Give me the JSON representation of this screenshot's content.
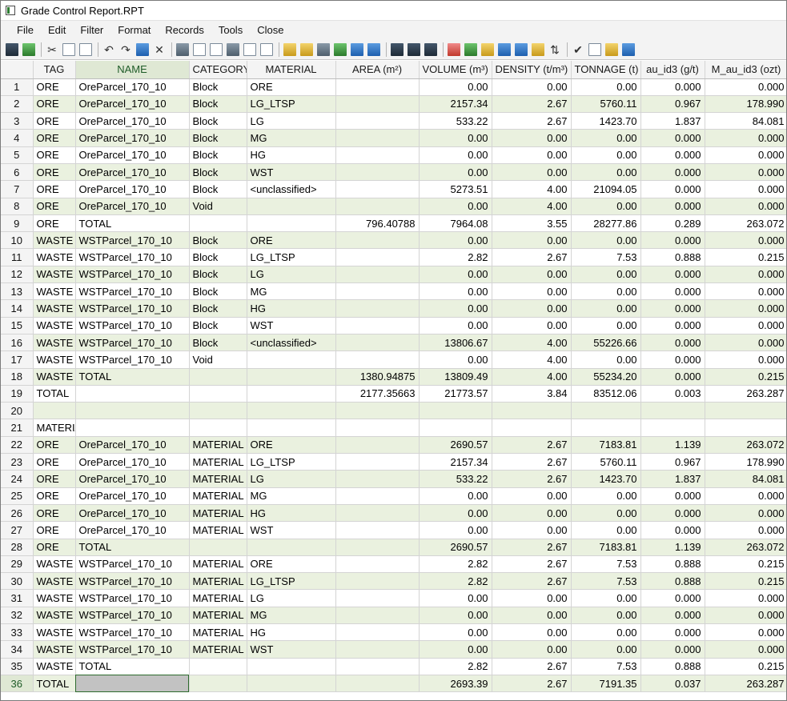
{
  "window": {
    "title": "Grade Control Report.RPT"
  },
  "menu": [
    "File",
    "Edit",
    "Filter",
    "Format",
    "Records",
    "Tools",
    "Close"
  ],
  "toolbar": {
    "icons": [
      "save-icon",
      "save-as-icon",
      "cut-icon",
      "copy-icon",
      "paste-icon",
      "undo-icon",
      "redo-icon",
      "insert-row-icon",
      "delete-icon",
      "filter-icon",
      "columns-icon",
      "format-icon",
      "wrap-icon",
      "decimal-increase-icon",
      "decimal-decrease-icon",
      "edit-icon",
      "edit-alt-icon",
      "export-icon",
      "add-column-icon",
      "import-icon",
      "download-icon",
      "calc-icon",
      "calc-alt-icon",
      "calc-edit-icon",
      "clear-icon",
      "table-icon",
      "chart-edit-icon",
      "merge-icon",
      "split-icon",
      "sort-icon",
      "sort-az-icon",
      "check-icon",
      "report-icon",
      "bar-chart-icon",
      "book-icon"
    ]
  },
  "grid": {
    "columns": [
      "TAG",
      "NAME",
      "CATEGORY",
      "MATERIAL",
      "AREA (m²)",
      "VOLUME (m³)",
      "DENSITY (t/m³)",
      "TONNAGE (t)",
      "au_id3 (g/t)",
      "M_au_id3 (ozt)"
    ],
    "rows": [
      {
        "n": "1",
        "band": false,
        "c": [
          "ORE",
          "OreParcel_170_10",
          "Block",
          "ORE",
          "",
          "0.00",
          "0.00",
          "0.00",
          "0.000",
          "0.000"
        ]
      },
      {
        "n": "2",
        "band": true,
        "c": [
          "ORE",
          "OreParcel_170_10",
          "Block",
          "LG_LTSP",
          "",
          "2157.34",
          "2.67",
          "5760.11",
          "0.967",
          "178.990"
        ]
      },
      {
        "n": "3",
        "band": false,
        "c": [
          "ORE",
          "OreParcel_170_10",
          "Block",
          "LG",
          "",
          "533.22",
          "2.67",
          "1423.70",
          "1.837",
          "84.081"
        ]
      },
      {
        "n": "4",
        "band": true,
        "c": [
          "ORE",
          "OreParcel_170_10",
          "Block",
          "MG",
          "",
          "0.00",
          "0.00",
          "0.00",
          "0.000",
          "0.000"
        ]
      },
      {
        "n": "5",
        "band": false,
        "c": [
          "ORE",
          "OreParcel_170_10",
          "Block",
          "HG",
          "",
          "0.00",
          "0.00",
          "0.00",
          "0.000",
          "0.000"
        ]
      },
      {
        "n": "6",
        "band": true,
        "c": [
          "ORE",
          "OreParcel_170_10",
          "Block",
          "WST",
          "",
          "0.00",
          "0.00",
          "0.00",
          "0.000",
          "0.000"
        ]
      },
      {
        "n": "7",
        "band": false,
        "c": [
          "ORE",
          "OreParcel_170_10",
          "Block",
          "<unclassified>",
          "",
          "5273.51",
          "4.00",
          "21094.05",
          "0.000",
          "0.000"
        ]
      },
      {
        "n": "8",
        "band": true,
        "c": [
          "ORE",
          "OreParcel_170_10",
          "Void",
          "",
          "",
          "0.00",
          "4.00",
          "0.00",
          "0.000",
          "0.000"
        ]
      },
      {
        "n": "9",
        "band": false,
        "c": [
          "ORE",
          "TOTAL",
          "",
          "",
          "796.40788",
          "7964.08",
          "3.55",
          "28277.86",
          "0.289",
          "263.072"
        ]
      },
      {
        "n": "10",
        "band": true,
        "c": [
          "WASTE",
          "WSTParcel_170_10",
          "Block",
          "ORE",
          "",
          "0.00",
          "0.00",
          "0.00",
          "0.000",
          "0.000"
        ]
      },
      {
        "n": "11",
        "band": false,
        "c": [
          "WASTE",
          "WSTParcel_170_10",
          "Block",
          "LG_LTSP",
          "",
          "2.82",
          "2.67",
          "7.53",
          "0.888",
          "0.215"
        ]
      },
      {
        "n": "12",
        "band": true,
        "c": [
          "WASTE",
          "WSTParcel_170_10",
          "Block",
          "LG",
          "",
          "0.00",
          "0.00",
          "0.00",
          "0.000",
          "0.000"
        ]
      },
      {
        "n": "13",
        "band": false,
        "c": [
          "WASTE",
          "WSTParcel_170_10",
          "Block",
          "MG",
          "",
          "0.00",
          "0.00",
          "0.00",
          "0.000",
          "0.000"
        ]
      },
      {
        "n": "14",
        "band": true,
        "c": [
          "WASTE",
          "WSTParcel_170_10",
          "Block",
          "HG",
          "",
          "0.00",
          "0.00",
          "0.00",
          "0.000",
          "0.000"
        ]
      },
      {
        "n": "15",
        "band": false,
        "c": [
          "WASTE",
          "WSTParcel_170_10",
          "Block",
          "WST",
          "",
          "0.00",
          "0.00",
          "0.00",
          "0.000",
          "0.000"
        ]
      },
      {
        "n": "16",
        "band": true,
        "c": [
          "WASTE",
          "WSTParcel_170_10",
          "Block",
          "<unclassified>",
          "",
          "13806.67",
          "4.00",
          "55226.66",
          "0.000",
          "0.000"
        ]
      },
      {
        "n": "17",
        "band": false,
        "c": [
          "WASTE",
          "WSTParcel_170_10",
          "Void",
          "",
          "",
          "0.00",
          "4.00",
          "0.00",
          "0.000",
          "0.000"
        ]
      },
      {
        "n": "18",
        "band": true,
        "c": [
          "WASTE",
          "TOTAL",
          "",
          "",
          "1380.94875",
          "13809.49",
          "4.00",
          "55234.20",
          "0.000",
          "0.215"
        ]
      },
      {
        "n": "19",
        "band": false,
        "c": [
          "TOTAL",
          "",
          "",
          "",
          "2177.35663",
          "21773.57",
          "3.84",
          "83512.06",
          "0.003",
          "263.287"
        ]
      },
      {
        "n": "20",
        "band": true,
        "c": [
          "",
          "",
          "",
          "",
          "",
          "",
          "",
          "",
          "",
          ""
        ]
      },
      {
        "n": "21",
        "band": false,
        "c": [
          "MATERI/",
          "",
          "",
          "",
          "",
          "",
          "",
          "",
          "",
          ""
        ]
      },
      {
        "n": "22",
        "band": true,
        "c": [
          "ORE",
          "OreParcel_170_10",
          "MATERIAL",
          "ORE",
          "",
          "2690.57",
          "2.67",
          "7183.81",
          "1.139",
          "263.072"
        ]
      },
      {
        "n": "23",
        "band": false,
        "c": [
          "ORE",
          "OreParcel_170_10",
          "MATERIAL",
          "LG_LTSP",
          "",
          "2157.34",
          "2.67",
          "5760.11",
          "0.967",
          "178.990"
        ]
      },
      {
        "n": "24",
        "band": true,
        "c": [
          "ORE",
          "OreParcel_170_10",
          "MATERIAL",
          "LG",
          "",
          "533.22",
          "2.67",
          "1423.70",
          "1.837",
          "84.081"
        ]
      },
      {
        "n": "25",
        "band": false,
        "c": [
          "ORE",
          "OreParcel_170_10",
          "MATERIAL",
          "MG",
          "",
          "0.00",
          "0.00",
          "0.00",
          "0.000",
          "0.000"
        ]
      },
      {
        "n": "26",
        "band": true,
        "c": [
          "ORE",
          "OreParcel_170_10",
          "MATERIAL",
          "HG",
          "",
          "0.00",
          "0.00",
          "0.00",
          "0.000",
          "0.000"
        ]
      },
      {
        "n": "27",
        "band": false,
        "c": [
          "ORE",
          "OreParcel_170_10",
          "MATERIAL",
          "WST",
          "",
          "0.00",
          "0.00",
          "0.00",
          "0.000",
          "0.000"
        ]
      },
      {
        "n": "28",
        "band": true,
        "c": [
          "ORE",
          "TOTAL",
          "",
          "",
          "",
          "2690.57",
          "2.67",
          "7183.81",
          "1.139",
          "263.072"
        ]
      },
      {
        "n": "29",
        "band": false,
        "c": [
          "WASTE",
          "WSTParcel_170_10",
          "MATERIAL",
          "ORE",
          "",
          "2.82",
          "2.67",
          "7.53",
          "0.888",
          "0.215"
        ]
      },
      {
        "n": "30",
        "band": true,
        "c": [
          "WASTE",
          "WSTParcel_170_10",
          "MATERIAL",
          "LG_LTSP",
          "",
          "2.82",
          "2.67",
          "7.53",
          "0.888",
          "0.215"
        ]
      },
      {
        "n": "31",
        "band": false,
        "c": [
          "WASTE",
          "WSTParcel_170_10",
          "MATERIAL",
          "LG",
          "",
          "0.00",
          "0.00",
          "0.00",
          "0.000",
          "0.000"
        ]
      },
      {
        "n": "32",
        "band": true,
        "c": [
          "WASTE",
          "WSTParcel_170_10",
          "MATERIAL",
          "MG",
          "",
          "0.00",
          "0.00",
          "0.00",
          "0.000",
          "0.000"
        ]
      },
      {
        "n": "33",
        "band": false,
        "c": [
          "WASTE",
          "WSTParcel_170_10",
          "MATERIAL",
          "HG",
          "",
          "0.00",
          "0.00",
          "0.00",
          "0.000",
          "0.000"
        ]
      },
      {
        "n": "34",
        "band": true,
        "c": [
          "WASTE",
          "WSTParcel_170_10",
          "MATERIAL",
          "WST",
          "",
          "0.00",
          "0.00",
          "0.00",
          "0.000",
          "0.000"
        ]
      },
      {
        "n": "35",
        "band": false,
        "c": [
          "WASTE",
          "TOTAL",
          "",
          "",
          "",
          "2.82",
          "2.67",
          "7.53",
          "0.888",
          "0.215"
        ]
      },
      {
        "n": "36",
        "band": true,
        "c": [
          "TOTAL",
          "",
          "",
          "",
          "",
          "2693.39",
          "2.67",
          "7191.35",
          "0.037",
          "263.287"
        ]
      }
    ],
    "selected_row": "36",
    "selected_column": "NAME",
    "colors": {
      "band": "#eaf1df",
      "selected_header": "#dfe8d4",
      "selected_cell": "#c2c2c2"
    }
  }
}
